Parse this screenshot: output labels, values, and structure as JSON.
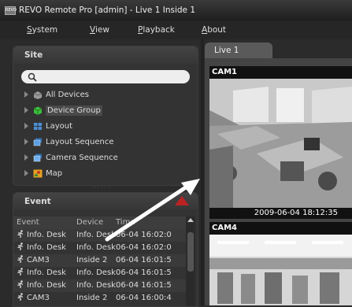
{
  "window": {
    "icon_text": "REVO",
    "title": "REVO Remote Pro [admin] - Live 1  Inside 1"
  },
  "menu": [
    {
      "label": "System",
      "hotkey": "S"
    },
    {
      "label": "View",
      "hotkey": "V"
    },
    {
      "label": "Playback",
      "hotkey": "P"
    },
    {
      "label": "About",
      "hotkey": "A"
    }
  ],
  "site_panel": {
    "title": "Site",
    "search": {
      "value": ""
    },
    "tree": [
      {
        "label": "All Devices",
        "icon": "cube-stack-icon"
      },
      {
        "label": "Device Group",
        "icon": "green-cube-icon",
        "selected": true
      },
      {
        "label": "Layout",
        "icon": "layout-grid-icon"
      },
      {
        "label": "Layout Sequence",
        "icon": "layout-sequence-icon"
      },
      {
        "label": "Camera Sequence",
        "icon": "camera-sequence-icon"
      },
      {
        "label": "Map",
        "icon": "map-icon"
      }
    ]
  },
  "event_panel": {
    "title": "Event",
    "columns": [
      "Event",
      "Device",
      "Time"
    ],
    "rows": [
      {
        "event": "Info. Desk",
        "device": "Info. Desk",
        "time": "06-04 16:02:0"
      },
      {
        "event": "Info. Desk",
        "device": "Info. Desk",
        "time": "06-04 16:02:0"
      },
      {
        "event": "CAM3",
        "device": "Inside 2",
        "time": "06-04 16:01:5"
      },
      {
        "event": "Info. Desk",
        "device": "Info. Desk",
        "time": "06-04 16:01:5"
      },
      {
        "event": "Info. Desk",
        "device": "Info. Desk",
        "time": "06-04 16:01:5"
      },
      {
        "event": "CAM3",
        "device": "Inside 2",
        "time": "06-04 16:00:4"
      }
    ]
  },
  "live": {
    "tab_label": "Live  1",
    "cameras": [
      {
        "label": "CAM1",
        "timestamp": "2009-06-04 18:12:35"
      },
      {
        "label": "CAM4",
        "timestamp": ""
      }
    ]
  }
}
